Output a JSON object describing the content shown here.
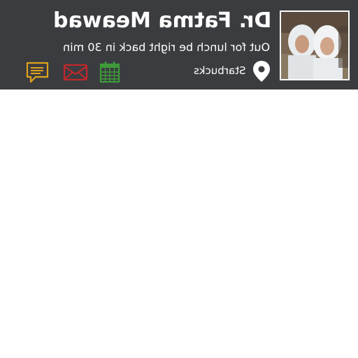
{
  "profile": {
    "name": "Dr. Fatma Meawad",
    "status": "Out for lunch be right back in 30 min",
    "location": "Starbucks"
  },
  "actions": [
    {
      "icon": "message-icon",
      "color": "#e0a21a"
    },
    {
      "icon": "mail-icon",
      "color": "#c0282a"
    },
    {
      "icon": "calendar-icon",
      "color": "#3f9a3a"
    }
  ],
  "colors": {
    "header_bg": "#3a3c40",
    "text": "#ffffff"
  }
}
